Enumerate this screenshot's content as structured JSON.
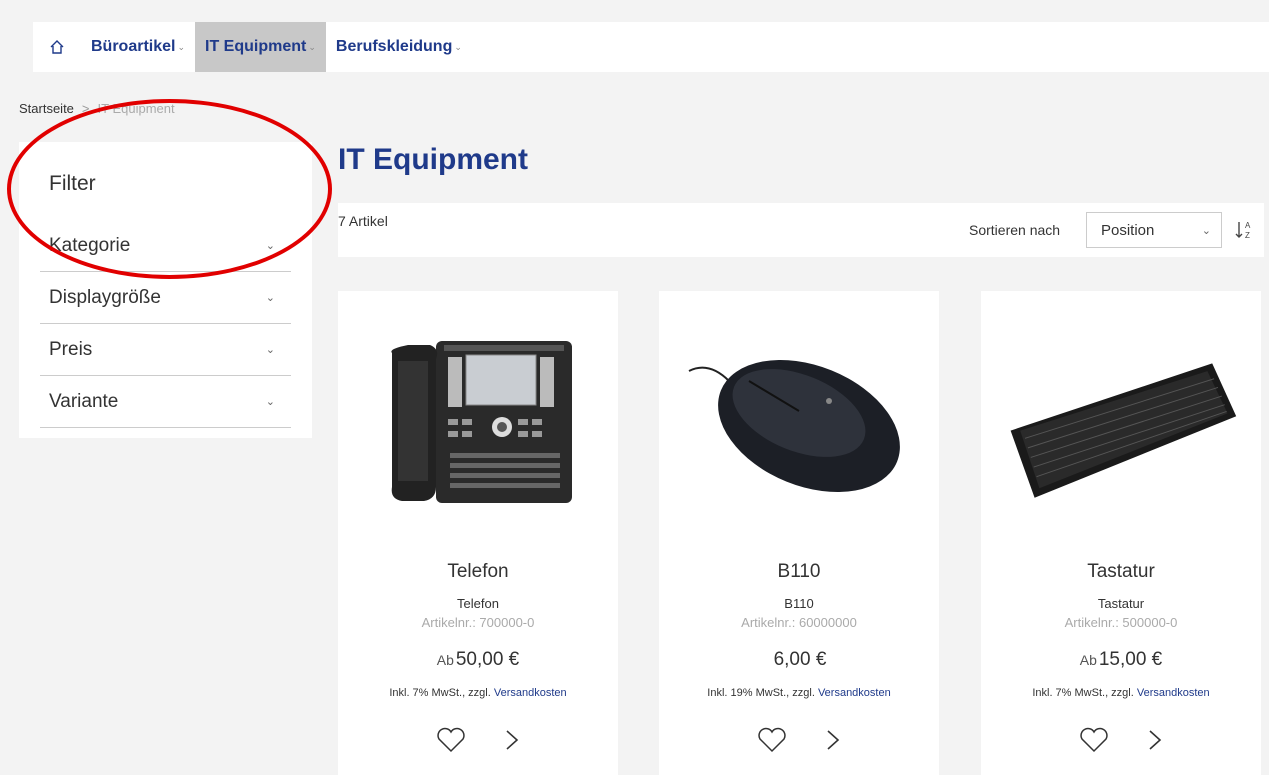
{
  "nav": {
    "home_icon": "home-icon",
    "items": [
      {
        "label": "Büroartikel",
        "active": false
      },
      {
        "label": "IT Equipment",
        "active": true
      },
      {
        "label": "Berufskleidung",
        "active": false
      }
    ]
  },
  "breadcrumb": {
    "home": "Startseite",
    "separator": ">",
    "current": "IT Equipment"
  },
  "filter": {
    "title": "Filter",
    "items": [
      "Kategorie",
      "Displaygröße",
      "Preis",
      "Variante"
    ]
  },
  "page": {
    "title": "IT Equipment",
    "count": "7 Artikel"
  },
  "sort": {
    "label": "Sortieren nach",
    "value": "Position"
  },
  "products": [
    {
      "name": "Telefon",
      "subtitle": "Telefon",
      "sku": "Artikelnr.:  700000-0",
      "price_prefix": "Ab",
      "price": "50,00 €",
      "tax_text": "Inkl. 7% MwSt., zzgl.",
      "shipping_link": "Versandkosten"
    },
    {
      "name": "B110",
      "subtitle": "B110",
      "sku": "Artikelnr.:  60000000",
      "price_prefix": "",
      "price": "6,00 €",
      "tax_text": "Inkl. 19% MwSt., zzgl.",
      "shipping_link": "Versandkosten"
    },
    {
      "name": "Tastatur",
      "subtitle": "Tastatur",
      "sku": "Artikelnr.:  500000-0",
      "price_prefix": "Ab",
      "price": "15,00 €",
      "tax_text": "Inkl. 7% MwSt., zzgl.",
      "shipping_link": "Versandkosten"
    }
  ],
  "colors": {
    "brand_blue": "#1f3a8a",
    "annotation_red": "#e10000",
    "active_nav_bg": "#c8c8c8"
  }
}
